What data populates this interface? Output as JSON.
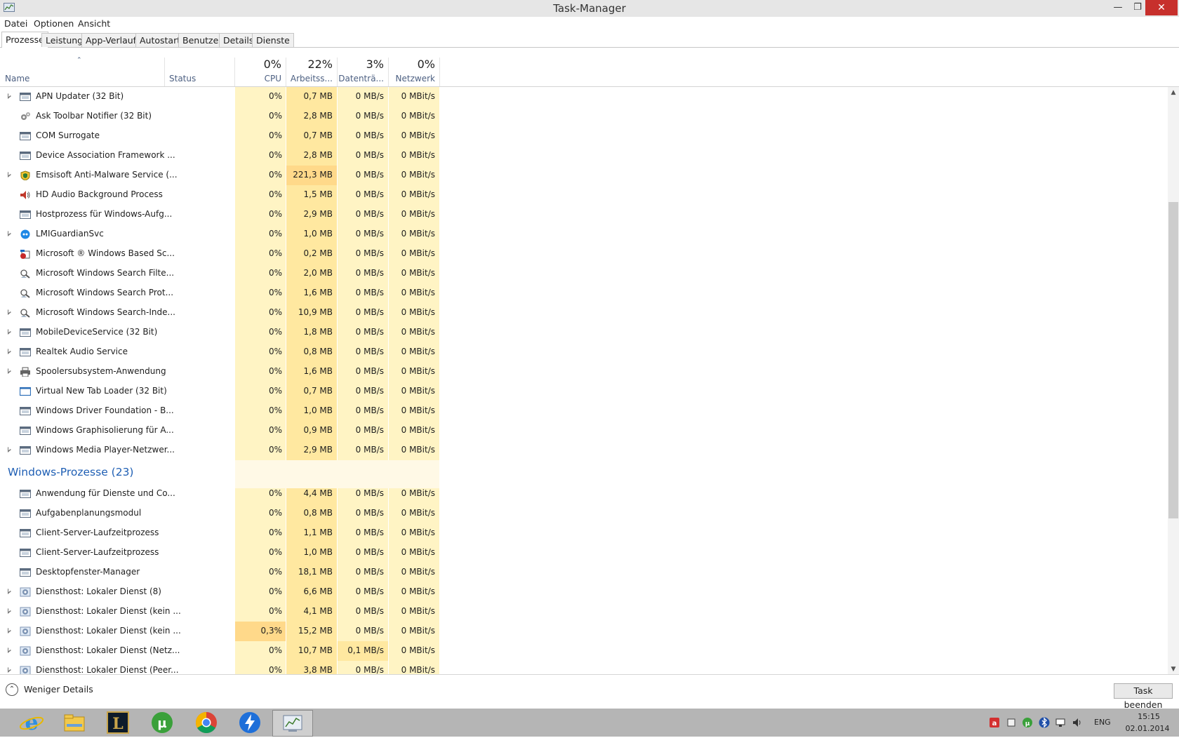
{
  "window": {
    "title": "Task-Manager"
  },
  "menu": [
    "Datei",
    "Optionen",
    "Ansicht"
  ],
  "tabs": [
    "Prozesse",
    "Leistung",
    "App-Verlauf",
    "Autostart",
    "Benutzer",
    "Details",
    "Dienste"
  ],
  "active_tab": "Prozesse",
  "columns": {
    "name": "Name",
    "status": "Status",
    "cpu": {
      "percent": "0%",
      "label": "CPU"
    },
    "memory": {
      "percent": "22%",
      "label": "Arbeitss..."
    },
    "disk": {
      "percent": "3%",
      "label": "Datenträ..."
    },
    "network": {
      "percent": "0%",
      "label": "Netzwerk"
    }
  },
  "background_processes": [
    {
      "name": "APN Updater (32 Bit)",
      "icon": "window-icon",
      "expandable": true,
      "cpu": "0%",
      "memory": "0,7 MB",
      "disk": "0 MB/s",
      "network": "0 MBit/s"
    },
    {
      "name": "Ask Toolbar Notifier (32 Bit)",
      "icon": "gears-icon",
      "expandable": false,
      "cpu": "0%",
      "memory": "2,8 MB",
      "disk": "0 MB/s",
      "network": "0 MBit/s"
    },
    {
      "name": "COM Surrogate",
      "icon": "window-icon",
      "expandable": false,
      "cpu": "0%",
      "memory": "0,7 MB",
      "disk": "0 MB/s",
      "network": "0 MBit/s"
    },
    {
      "name": "Device Association Framework ...",
      "icon": "window-icon",
      "expandable": false,
      "cpu": "0%",
      "memory": "2,8 MB",
      "disk": "0 MB/s",
      "network": "0 MBit/s"
    },
    {
      "name": "Emsisoft Anti-Malware Service (...",
      "icon": "shield-icon",
      "expandable": true,
      "cpu": "0%",
      "memory": "221,3 MB",
      "disk": "0 MB/s",
      "network": "0 MBit/s",
      "memory_hot": true
    },
    {
      "name": "HD Audio Background Process",
      "icon": "speaker-icon",
      "expandable": false,
      "cpu": "0%",
      "memory": "1,5 MB",
      "disk": "0 MB/s",
      "network": "0 MBit/s"
    },
    {
      "name": "Hostprozess für Windows-Aufg...",
      "icon": "window-icon",
      "expandable": false,
      "cpu": "0%",
      "memory": "2,9 MB",
      "disk": "0 MB/s",
      "network": "0 MBit/s"
    },
    {
      "name": "LMIGuardianSvc",
      "icon": "blue-circle-icon",
      "expandable": true,
      "cpu": "0%",
      "memory": "1,0 MB",
      "disk": "0 MB/s",
      "network": "0 MBit/s"
    },
    {
      "name": "Microsoft ® Windows Based Sc...",
      "icon": "script-icon",
      "expandable": false,
      "cpu": "0%",
      "memory": "0,2 MB",
      "disk": "0 MB/s",
      "network": "0 MBit/s"
    },
    {
      "name": "Microsoft Windows Search Filte...",
      "icon": "search-person-icon",
      "expandable": false,
      "cpu": "0%",
      "memory": "2,0 MB",
      "disk": "0 MB/s",
      "network": "0 MBit/s"
    },
    {
      "name": "Microsoft Windows Search Prot...",
      "icon": "search-person-icon",
      "expandable": false,
      "cpu": "0%",
      "memory": "1,6 MB",
      "disk": "0 MB/s",
      "network": "0 MBit/s"
    },
    {
      "name": "Microsoft Windows Search-Inde...",
      "icon": "search-person-icon",
      "expandable": true,
      "cpu": "0%",
      "memory": "10,9 MB",
      "disk": "0 MB/s",
      "network": "0 MBit/s"
    },
    {
      "name": "MobileDeviceService (32 Bit)",
      "icon": "window-icon",
      "expandable": true,
      "cpu": "0%",
      "memory": "1,8 MB",
      "disk": "0 MB/s",
      "network": "0 MBit/s"
    },
    {
      "name": "Realtek Audio Service",
      "icon": "window-icon",
      "expandable": true,
      "cpu": "0%",
      "memory": "0,8 MB",
      "disk": "0 MB/s",
      "network": "0 MBit/s"
    },
    {
      "name": "Spoolersubsystem-Anwendung",
      "icon": "printer-icon",
      "expandable": true,
      "cpu": "0%",
      "memory": "1,6 MB",
      "disk": "0 MB/s",
      "network": "0 MBit/s"
    },
    {
      "name": "Virtual New Tab Loader (32 Bit)",
      "icon": "blank-window-icon",
      "expandable": false,
      "cpu": "0%",
      "memory": "0,7 MB",
      "disk": "0 MB/s",
      "network": "0 MBit/s"
    },
    {
      "name": "Windows Driver Foundation - B...",
      "icon": "window-icon",
      "expandable": false,
      "cpu": "0%",
      "memory": "1,0 MB",
      "disk": "0 MB/s",
      "network": "0 MBit/s"
    },
    {
      "name": "Windows Graphisolierung für A...",
      "icon": "window-icon",
      "expandable": false,
      "cpu": "0%",
      "memory": "0,9 MB",
      "disk": "0 MB/s",
      "network": "0 MBit/s"
    },
    {
      "name": "Windows Media Player-Netzwer...",
      "icon": "window-icon",
      "expandable": true,
      "cpu": "0%",
      "memory": "2,9 MB",
      "disk": "0 MB/s",
      "network": "0 MBit/s"
    }
  ],
  "windows_group": {
    "label": "Windows-Prozesse (23)"
  },
  "windows_processes": [
    {
      "name": "Anwendung für Dienste und Co...",
      "icon": "window-icon",
      "expandable": false,
      "cpu": "0%",
      "memory": "4,4 MB",
      "disk": "0 MB/s",
      "network": "0 MBit/s"
    },
    {
      "name": "Aufgabenplanungsmodul",
      "icon": "window-icon",
      "expandable": false,
      "cpu": "0%",
      "memory": "0,8 MB",
      "disk": "0 MB/s",
      "network": "0 MBit/s"
    },
    {
      "name": "Client-Server-Laufzeitprozess",
      "icon": "window-icon",
      "expandable": false,
      "cpu": "0%",
      "memory": "1,1 MB",
      "disk": "0 MB/s",
      "network": "0 MBit/s"
    },
    {
      "name": "Client-Server-Laufzeitprozess",
      "icon": "window-icon",
      "expandable": false,
      "cpu": "0%",
      "memory": "1,0 MB",
      "disk": "0 MB/s",
      "network": "0 MBit/s"
    },
    {
      "name": "Desktopfenster-Manager",
      "icon": "window-icon",
      "expandable": false,
      "cpu": "0%",
      "memory": "18,1 MB",
      "disk": "0 MB/s",
      "network": "0 MBit/s"
    },
    {
      "name": "Diensthost: Lokaler Dienst (8)",
      "icon": "gear-icon",
      "expandable": true,
      "cpu": "0%",
      "memory": "6,6 MB",
      "disk": "0 MB/s",
      "network": "0 MBit/s"
    },
    {
      "name": "Diensthost: Lokaler Dienst (kein ...",
      "icon": "gear-icon",
      "expandable": true,
      "cpu": "0%",
      "memory": "4,1 MB",
      "disk": "0 MB/s",
      "network": "0 MBit/s"
    },
    {
      "name": "Diensthost: Lokaler Dienst (kein ...",
      "icon": "gear-icon",
      "expandable": true,
      "cpu": "0,3%",
      "memory": "15,2 MB",
      "disk": "0 MB/s",
      "network": "0 MBit/s",
      "cpu_hot": true
    },
    {
      "name": "Diensthost: Lokaler Dienst (Netz...",
      "icon": "gear-icon",
      "expandable": true,
      "cpu": "0%",
      "memory": "10,7 MB",
      "disk": "0,1 MB/s",
      "network": "0 MBit/s",
      "disk_hot": true
    },
    {
      "name": "Diensthost: Lokaler Dienst (Peer...",
      "icon": "gear-icon",
      "expandable": true,
      "cpu": "0%",
      "memory": "3,8 MB",
      "disk": "0 MB/s",
      "network": "0 MBit/s"
    }
  ],
  "footer": {
    "fewer_details": "Weniger Details",
    "end_task": "Task beenden"
  },
  "taskbar": {
    "apps": [
      "internet-explorer-icon",
      "file-explorer-icon",
      "league-of-legends-icon",
      "utorrent-icon",
      "chrome-icon",
      "thunder-icon",
      "task-manager-icon"
    ],
    "language": "ENG",
    "time": "15:15",
    "date": "02.01.2014"
  },
  "colors": {
    "heat_light": "#fff4c4",
    "heat_medium": "#ffe8a0",
    "heat_strong": "#ffd98a",
    "group_header": "#1f5fb4",
    "close_button": "#c7302c"
  }
}
